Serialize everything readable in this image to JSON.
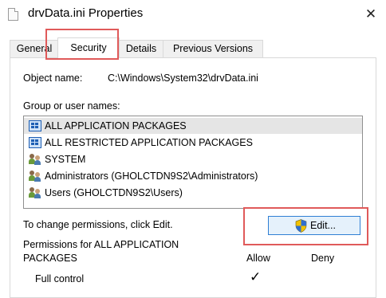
{
  "window": {
    "title": "drvData.ini Properties",
    "close_glyph": "✕"
  },
  "tabs": [
    {
      "label": "General",
      "active": false
    },
    {
      "label": "Security",
      "active": true
    },
    {
      "label": "Details",
      "active": false
    },
    {
      "label": "Previous Versions",
      "active": false
    }
  ],
  "security": {
    "object_name_label": "Object name:",
    "object_name_value": "C:\\Windows\\System32\\drvData.ini",
    "group_label": "Group or user names:",
    "groups": [
      {
        "name": "ALL APPLICATION PACKAGES",
        "icon": "package-icon",
        "selected": true
      },
      {
        "name": "ALL RESTRICTED APPLICATION PACKAGES",
        "icon": "package-icon",
        "selected": false
      },
      {
        "name": "SYSTEM",
        "icon": "users-icon",
        "selected": false
      },
      {
        "name": "Administrators (GHOLCTDN9S2\\Administrators)",
        "icon": "users-icon",
        "selected": false
      },
      {
        "name": "Users (GHOLCTDN9S2\\Users)",
        "icon": "users-icon",
        "selected": false
      }
    ],
    "change_text": "To change permissions, click Edit.",
    "edit_label": "Edit...",
    "permissions_label_line1": "Permissions for ALL APPLICATION",
    "permissions_label_line2": "PACKAGES",
    "allow_header": "Allow",
    "deny_header": "Deny",
    "permissions": [
      {
        "name": "Full control",
        "allow": true,
        "deny": false
      }
    ],
    "check_glyph": "✓"
  },
  "colors": {
    "highlight": "#e05a5a",
    "button_border": "#2f7fd4",
    "button_bg": "#e5f1fb",
    "selection": "#e5e5e5"
  }
}
